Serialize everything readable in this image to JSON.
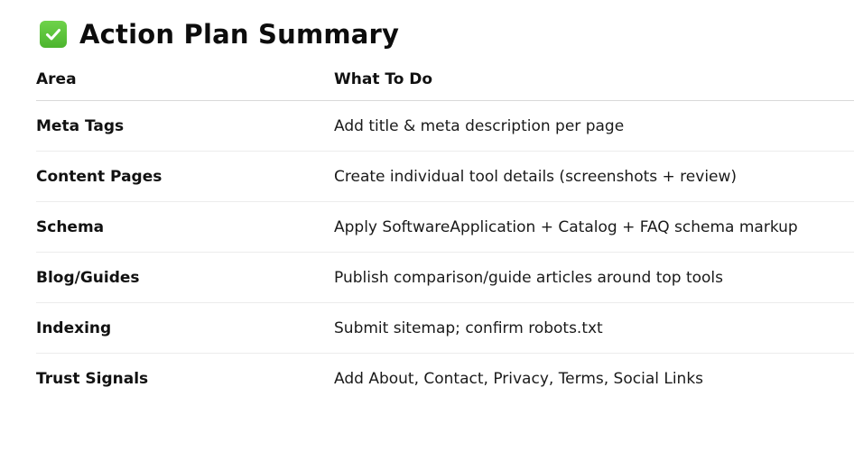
{
  "heading": {
    "icon": "check-mark-button-icon",
    "title": "Action Plan Summary"
  },
  "table": {
    "columns": [
      "Area",
      "What To Do"
    ],
    "rows": [
      {
        "area": "Meta Tags",
        "todo": "Add title & meta description per page"
      },
      {
        "area": "Content Pages",
        "todo": "Create individual tool details (screenshots + review)"
      },
      {
        "area": "Schema",
        "todo": "Apply SoftwareApplication + Catalog + FAQ schema markup"
      },
      {
        "area": "Blog/Guides",
        "todo": "Publish comparison/guide articles around top tools"
      },
      {
        "area": "Indexing",
        "todo": "Submit sitemap; confirm robots.txt"
      },
      {
        "area": "Trust Signals",
        "todo": "Add About, Contact, Privacy, Terms, Social Links"
      }
    ]
  },
  "colors": {
    "check_green": "#5cc43a",
    "text": "#111111",
    "divider": "#ececec"
  }
}
